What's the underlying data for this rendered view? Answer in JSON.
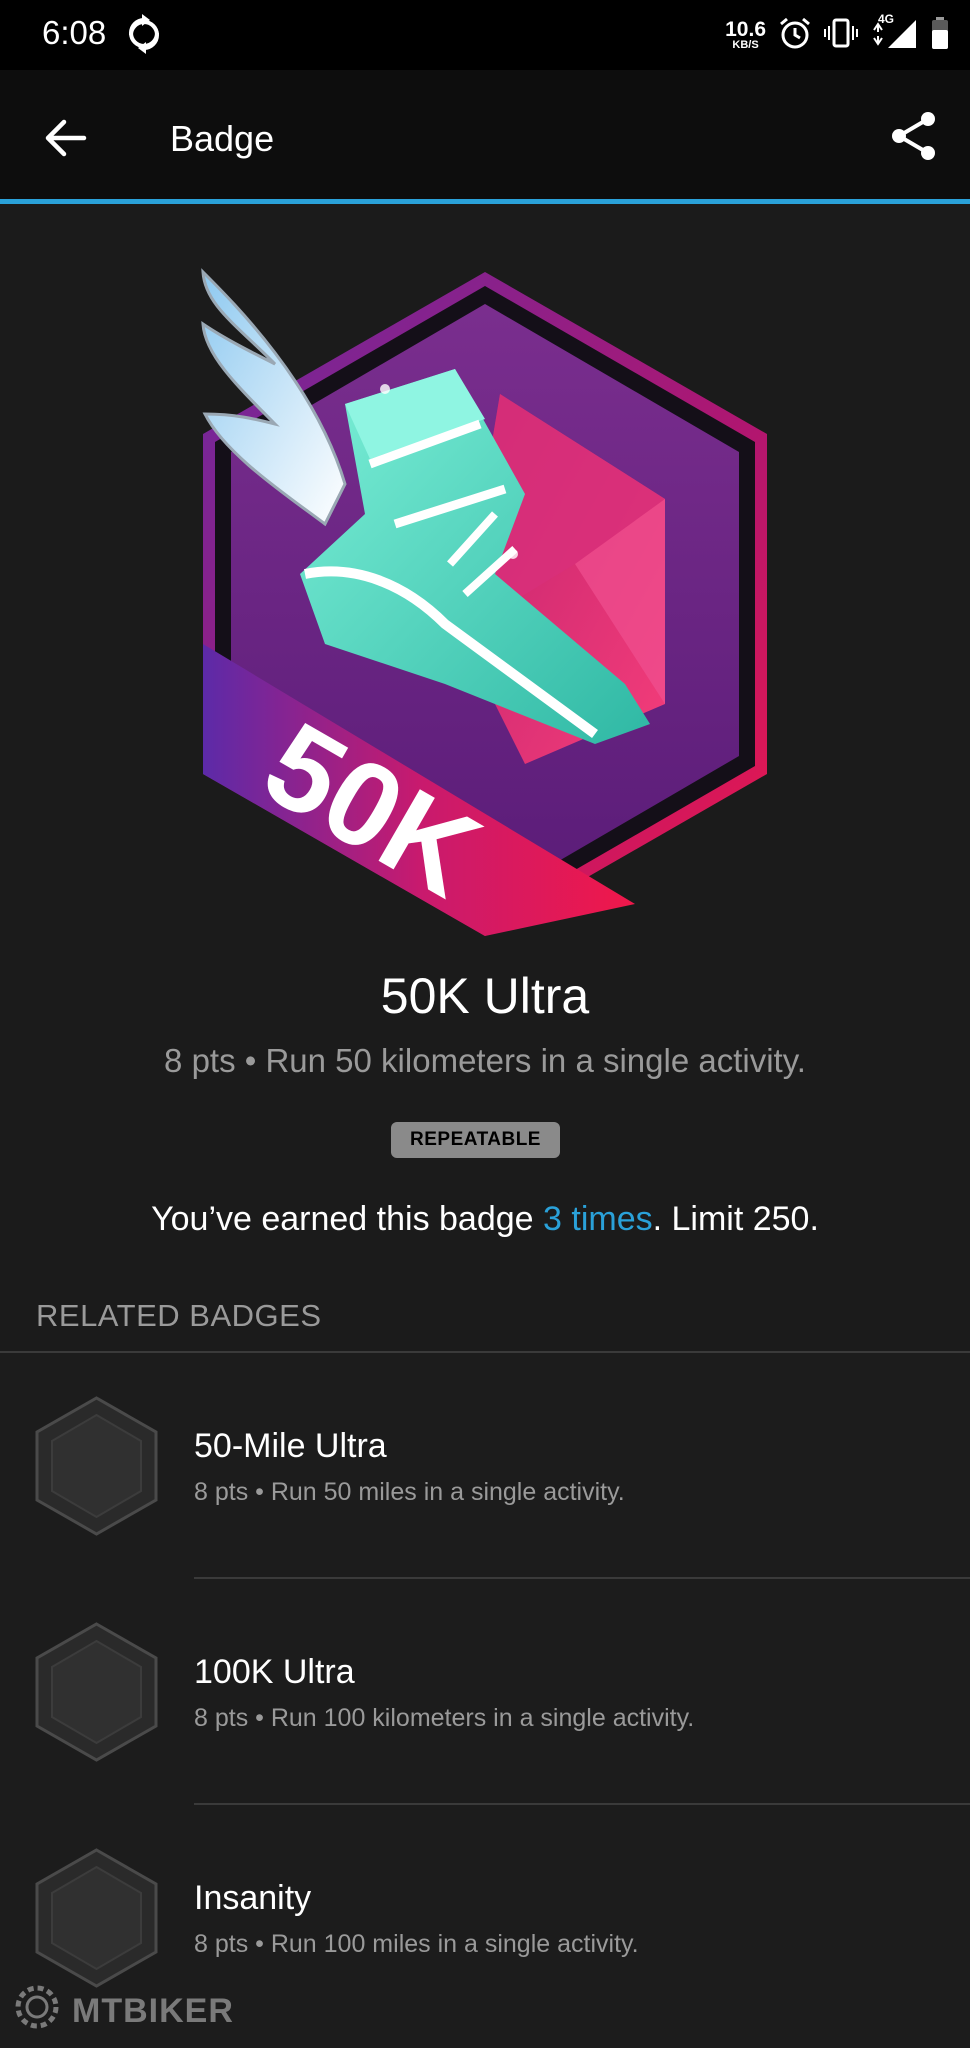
{
  "status_bar": {
    "time": "6:08",
    "net_speed_value": "10.6",
    "net_speed_unit": "KB/S",
    "network": "4G"
  },
  "app_bar": {
    "title": "Badge"
  },
  "badge": {
    "art_text": "50K",
    "name": "50K Ultra",
    "description": "8 pts • Run 50 kilometers in a single activity.",
    "tag": "REPEATABLE",
    "earned_prefix": "You’ve earned this badge ",
    "earned_times": "3 times",
    "earned_suffix": ". Limit 250."
  },
  "related": {
    "heading": "RELATED BADGES",
    "items": [
      {
        "name": "50-Mile Ultra",
        "description": "8 pts • Run 50 miles in a single activity."
      },
      {
        "name": "100K Ultra",
        "description": "8 pts • Run 100 kilometers in a single activity."
      },
      {
        "name": "Insanity",
        "description": "8 pts • Run 100 miles in a single activity."
      }
    ]
  },
  "watermark": {
    "text": "MTBIKER"
  },
  "colors": {
    "accent": "#2aa1d9",
    "background": "#1b1b1b",
    "badge_purple": "#6a2a86",
    "badge_pink": "#e8185a",
    "badge_teal": "#4fd6bf"
  }
}
